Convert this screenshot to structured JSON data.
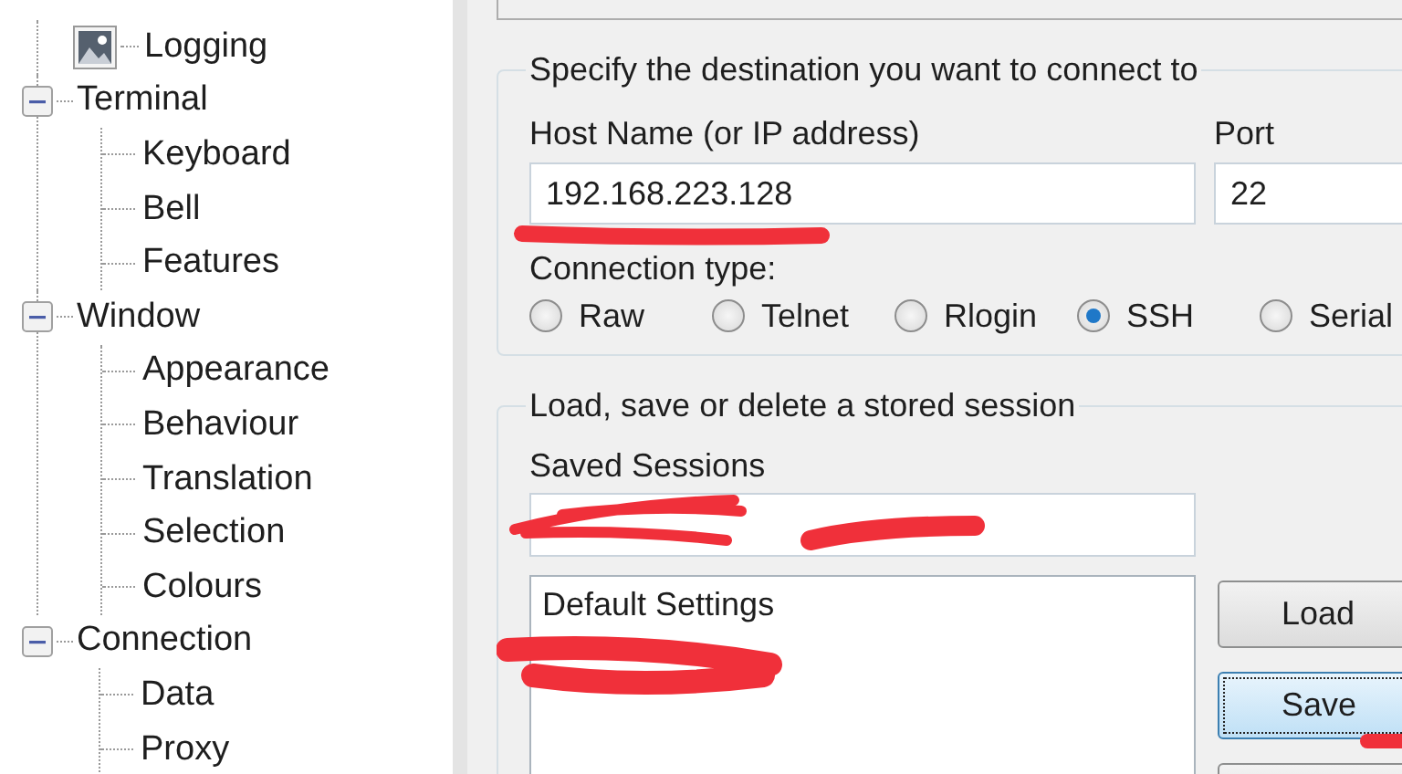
{
  "tree": [
    {
      "label": "Logging",
      "kind": "leaf"
    },
    {
      "label": "Terminal",
      "kind": "node",
      "expanded": true,
      "children": [
        {
          "label": "Keyboard"
        },
        {
          "label": "Bell"
        },
        {
          "label": "Features"
        }
      ]
    },
    {
      "label": "Window",
      "kind": "node",
      "expanded": true,
      "children": [
        {
          "label": "Appearance"
        },
        {
          "label": "Behaviour"
        },
        {
          "label": "Translation"
        },
        {
          "label": "Selection"
        },
        {
          "label": "Colours"
        }
      ]
    },
    {
      "label": "Connection",
      "kind": "node",
      "expanded": true,
      "children": [
        {
          "label": "Data"
        },
        {
          "label": "Proxy"
        }
      ]
    }
  ],
  "destination": {
    "title": "Specify the destination you want to connect to",
    "host_label": "Host Name (or IP address)",
    "host_value": "192.168.223.128",
    "port_label": "Port",
    "port_value": "22",
    "connection_type_label": "Connection type:",
    "connection_types": [
      {
        "label": "Raw",
        "selected": false
      },
      {
        "label": "Telnet",
        "selected": false
      },
      {
        "label": "Rlogin",
        "selected": false
      },
      {
        "label": "SSH",
        "selected": true
      },
      {
        "label": "Serial",
        "selected": false
      }
    ]
  },
  "sessions": {
    "title": "Load, save or delete a stored session",
    "saved_label": "Saved Sessions",
    "saved_sessions": [
      "Default Settings"
    ],
    "buttons": [
      {
        "label": "Load",
        "default": false
      },
      {
        "label": "Save",
        "default": true
      }
    ]
  }
}
